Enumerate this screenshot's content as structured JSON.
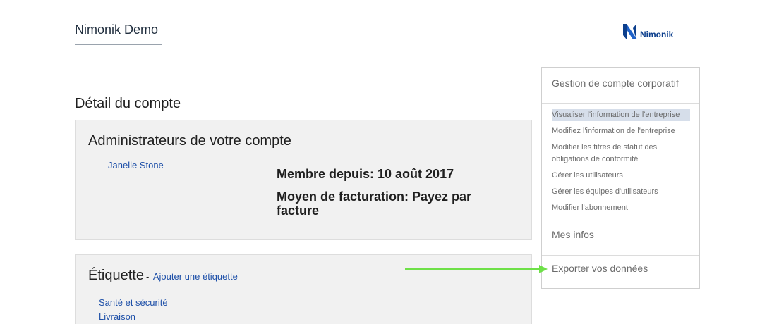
{
  "header": {
    "app_title": "Nimonik Demo",
    "logo_text": "Nimonik",
    "logo_icon": "nimonik-n-logo-icon"
  },
  "page": {
    "title": "Détail du compte"
  },
  "admins_panel": {
    "heading": "Administrateurs de votre compte",
    "admin_name": "Janelle Stone",
    "member_since": "Membre depuis: 10 août 2017",
    "billing": "Moyen de facturation: Payez par facture"
  },
  "labels_panel": {
    "heading": "Étiquette",
    "separator": "-",
    "add_link": "Ajouter une étiquette",
    "items": [
      "Santé et sécurité",
      "Livraison"
    ]
  },
  "sidebar": {
    "section_title": "Gestion de compte corporatif",
    "menu": [
      "Visualiser l'information de l'entreprise",
      "Modifiez l'information de l'entreprise",
      "Modifier les titres de statut des obligations de conformité",
      "Gérer les utilisateurs",
      "Gérer les équipes d'utilisateurs",
      "Modifier l'abonnement"
    ],
    "mes_infos": "Mes infos",
    "export": "Exporter vos données"
  },
  "colors": {
    "link": "#1d4fa8",
    "panel_bg": "#f1f1f1",
    "active_menu_bg": "#d6deea",
    "annotation_arrow": "#6ee048",
    "logo_blue": "#0b3e8c"
  }
}
